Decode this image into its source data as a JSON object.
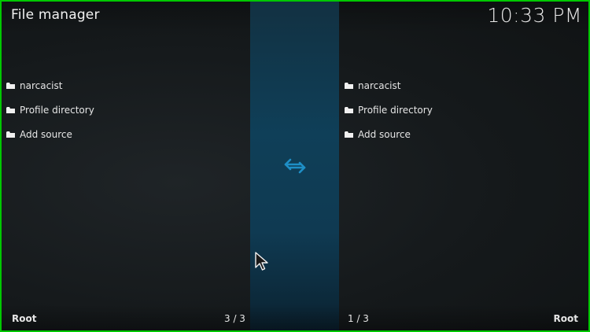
{
  "header": {
    "title": "File manager",
    "clock": "10:33 PM"
  },
  "left_pane": {
    "items": [
      {
        "label": "narcacist",
        "icon": "folder-icon"
      },
      {
        "label": "Profile directory",
        "icon": "folder-icon"
      },
      {
        "label": "Add source",
        "icon": "folder-icon"
      }
    ],
    "footer_path": "Root",
    "footer_count": "3 / 3"
  },
  "right_pane": {
    "items": [
      {
        "label": "narcacist",
        "icon": "folder-icon"
      },
      {
        "label": "Profile directory",
        "icon": "folder-icon"
      },
      {
        "label": "Add source",
        "icon": "folder-icon"
      }
    ],
    "footer_path": "Root",
    "footer_count": "1 / 3"
  },
  "center": {
    "icon": "swap-arrows-icon",
    "accent_color": "#1e8fc6"
  },
  "frame_color": "#00c800"
}
